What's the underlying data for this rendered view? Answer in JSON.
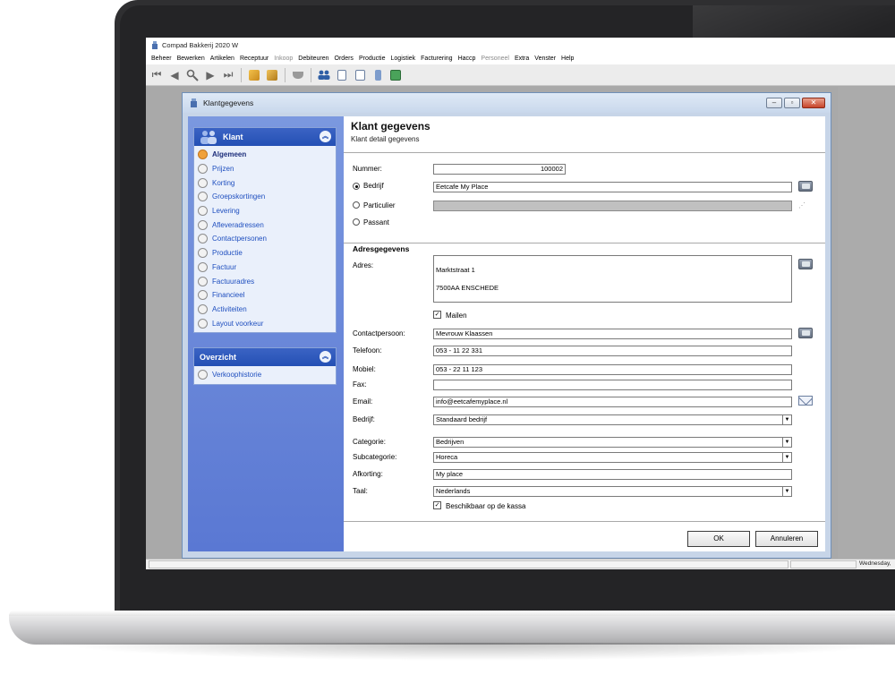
{
  "app": {
    "title": "Compad Bakkerij 2020 W",
    "menu": [
      {
        "label": "Beheer",
        "enabled": true
      },
      {
        "label": "Bewerken",
        "enabled": true
      },
      {
        "label": "Artikelen",
        "enabled": true
      },
      {
        "label": "Receptuur",
        "enabled": true
      },
      {
        "label": "Inkoop",
        "enabled": false
      },
      {
        "label": "Debiteuren",
        "enabled": true
      },
      {
        "label": "Orders",
        "enabled": true
      },
      {
        "label": "Productie",
        "enabled": true
      },
      {
        "label": "Logistiek",
        "enabled": true
      },
      {
        "label": "Facturering",
        "enabled": true
      },
      {
        "label": "Haccp",
        "enabled": true
      },
      {
        "label": "Personeel",
        "enabled": false
      },
      {
        "label": "Extra",
        "enabled": true
      },
      {
        "label": "Venster",
        "enabled": true
      },
      {
        "label": "Help",
        "enabled": true
      }
    ],
    "status": {
      "date": "Wednesday, "
    }
  },
  "dialog": {
    "title": "Klantgegevens",
    "header": {
      "title": "Klant gegevens",
      "subtitle": "Klant detail gegevens"
    },
    "nav": {
      "klant": {
        "title": "Klant",
        "items": [
          "Algemeen",
          "Prijzen",
          "Korting",
          "Groepskortingen",
          "Levering",
          "Afleveradressen",
          "Contactpersonen",
          "Productie",
          "Factuur",
          "Factuuradres",
          "Financieel",
          "Activiteiten",
          "Layout voorkeur"
        ],
        "active": "Algemeen"
      },
      "overzicht": {
        "title": "Overzicht",
        "items": [
          "Verkoophistorie"
        ]
      }
    },
    "form": {
      "nummer": {
        "label": "Nummer:",
        "value": "100002"
      },
      "bedrijf_radio": {
        "label": "Bedrijf",
        "value": "Eetcafe My Place",
        "selected": true
      },
      "particulier_radio": {
        "label": "Particulier",
        "selected": false
      },
      "passant_radio": {
        "label": "Passant",
        "selected": false
      },
      "adres_section": "Adresgegevens",
      "adres": {
        "label": "Adres:",
        "line1": "Marktstraat 1",
        "line2": "7500AA  ENSCHEDE"
      },
      "mailen": {
        "label": "Mailen",
        "checked": true
      },
      "contactpersoon": {
        "label": "Contactpersoon:",
        "value": "Mevrouw Klaassen"
      },
      "telefoon": {
        "label": "Telefoon:",
        "value": "053 - 11 22 331"
      },
      "mobiel": {
        "label": "Mobiel:",
        "value": "053 - 22 11 123"
      },
      "fax": {
        "label": "Fax:",
        "value": ""
      },
      "email": {
        "label": "Email:",
        "value": "info@eetcafemyplace.nl"
      },
      "bedrijf": {
        "label": "Bedrijf:",
        "value": "Standaard bedrijf"
      },
      "categorie": {
        "label": "Categorie:",
        "value": "Bedrijven"
      },
      "subcategorie": {
        "label": "Subcategorie:",
        "value": "Horeca"
      },
      "afkorting": {
        "label": "Afkorting:",
        "value": "My place"
      },
      "taal": {
        "label": "Taal:",
        "value": "Nederlands"
      },
      "kassa": {
        "label": "Beschikbaar op de kassa",
        "checked": true
      }
    },
    "buttons": {
      "ok": "OK",
      "cancel": "Annuleren"
    },
    "check_mark": "✓",
    "dropdown_arrow": "▼"
  },
  "icons": {
    "toolbar": [
      "first-record-icon",
      "previous-record-icon",
      "search-icon",
      "next-record-icon",
      "last-record-icon",
      "refresh-icon",
      "stock-icon",
      "basket-icon",
      "customers-icon",
      "document-icon",
      "calendar-icon",
      "recipe-icon",
      "cash-icon"
    ],
    "form": [
      "address-book-icon",
      "envelope-icon"
    ]
  },
  "colors": {
    "nav_header": "#2450b4",
    "nav_background": "#6a88d9",
    "active_radio": "#f0a13a",
    "nav_link": "#1f4fbf"
  }
}
